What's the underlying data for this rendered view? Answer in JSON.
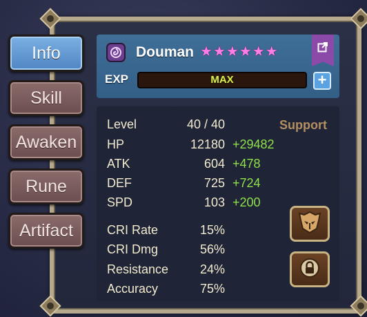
{
  "tabs": [
    {
      "label": "Info",
      "active": true
    },
    {
      "label": "Skill",
      "active": false
    },
    {
      "label": "Awaken",
      "active": false
    },
    {
      "label": "Rune",
      "active": false
    },
    {
      "label": "Artifact",
      "active": false
    }
  ],
  "monster": {
    "name": "Douman",
    "stars": 6,
    "star_glyph": "★",
    "element_icon": "dark-element-icon",
    "role": "Support"
  },
  "exp": {
    "label": "EXP",
    "value": "MAX"
  },
  "stats": [
    {
      "label": "Level",
      "value": "40 / 40",
      "bonus": ""
    },
    {
      "label": "HP",
      "value": "12180",
      "bonus": "+29482"
    },
    {
      "label": "ATK",
      "value": "604",
      "bonus": "+478"
    },
    {
      "label": "DEF",
      "value": "725",
      "bonus": "+724"
    },
    {
      "label": "SPD",
      "value": "103",
      "bonus": "+200"
    },
    {
      "label": "CRI Rate",
      "value": "15%",
      "bonus": ""
    },
    {
      "label": "CRI Dmg",
      "value": "56%",
      "bonus": ""
    },
    {
      "label": "Resistance",
      "value": "24%",
      "bonus": ""
    },
    {
      "label": "Accuracy",
      "value": "75%",
      "bonus": ""
    }
  ],
  "colors": {
    "active_tab": "#5a93cd",
    "inactive_tab": "#7a5b5c",
    "star": "#ff7de6",
    "bonus_text": "#8fe14a",
    "role_text": "#b48f61",
    "exp_text": "#d8f44a"
  },
  "icons": {
    "share": "share-icon",
    "plus": "plus-icon",
    "mask": "mask-icon",
    "lock": "lock-icon"
  }
}
